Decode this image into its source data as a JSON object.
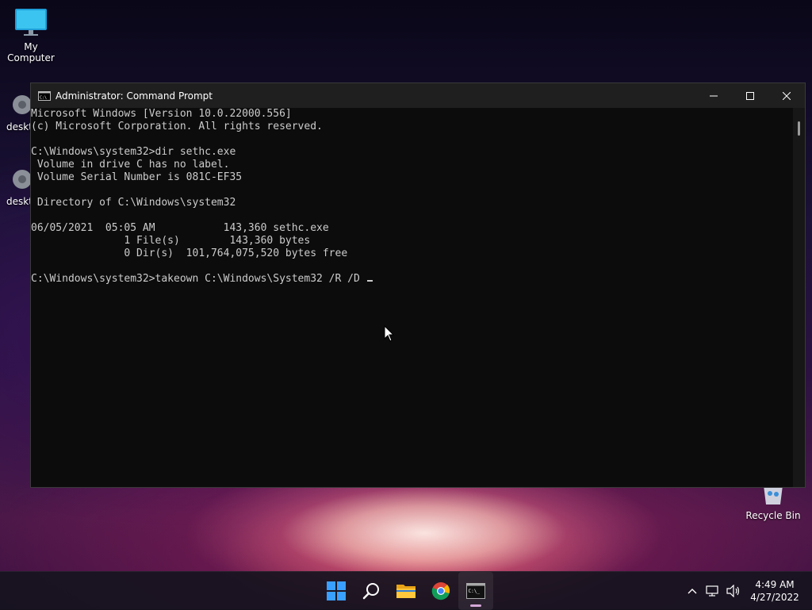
{
  "desktop": {
    "my_computer_label": "My Computer",
    "recycle_bin_label": "Recycle Bin",
    "partial_icon_1_label": "deskt",
    "partial_icon_2_label": "deskt"
  },
  "window": {
    "title": "Administrator: Command Prompt",
    "console_lines": [
      "Microsoft Windows [Version 10.0.22000.556]",
      "(c) Microsoft Corporation. All rights reserved.",
      "",
      "C:\\Windows\\system32>dir sethc.exe",
      " Volume in drive C has no label.",
      " Volume Serial Number is 081C-EF35",
      "",
      " Directory of C:\\Windows\\system32",
      "",
      "06/05/2021  05:05 AM           143,360 sethc.exe",
      "               1 File(s)        143,360 bytes",
      "               0 Dir(s)  101,764,075,520 bytes free",
      "",
      "C:\\Windows\\system32>takeown C:\\Windows\\System32 /R /D "
    ]
  },
  "taskbar": {
    "apps": [
      "start-button",
      "search-button",
      "file-explorer-button",
      "chrome-button",
      "command-prompt-button"
    ],
    "time": "4:49 AM",
    "date": "4/27/2022"
  },
  "colors": {
    "console_bg": "#0c0c0c",
    "console_text": "#cccccc",
    "titlebar_bg": "#1f1f1f"
  }
}
